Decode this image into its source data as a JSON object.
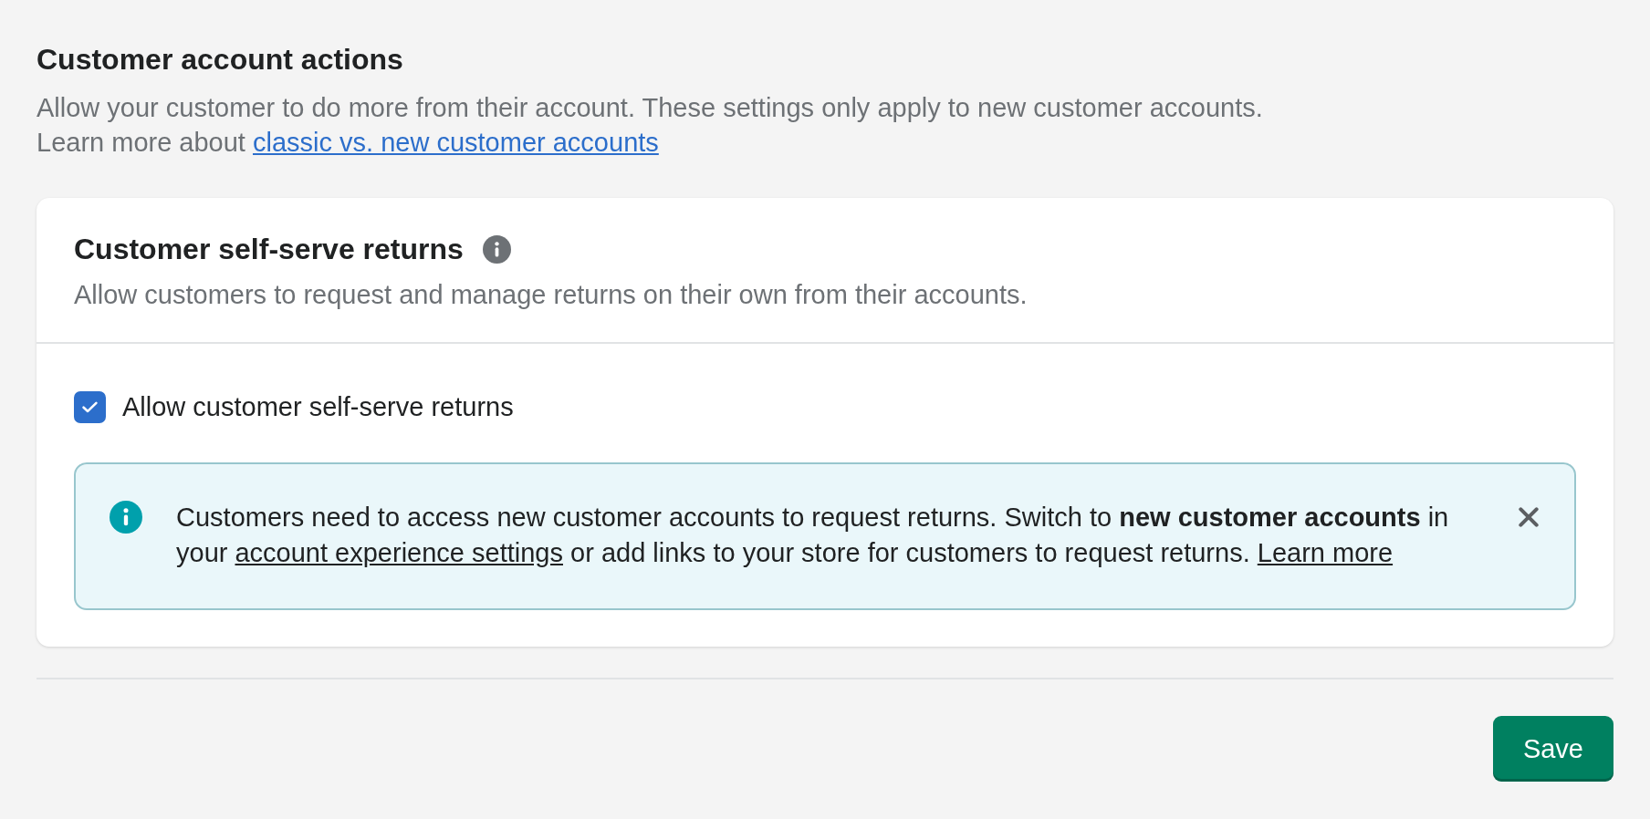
{
  "section": {
    "title": "Customer account actions",
    "description": "Allow your customer to do more from their account. These settings only apply to new customer accounts.",
    "learn_more": {
      "text": "Learn more about",
      "link": "classic vs. new customer accounts"
    }
  },
  "card": {
    "title": "Customer self-serve returns",
    "description": "Allow customers to request and manage returns on their own from their accounts.",
    "checkbox": {
      "label": "Allow customer self-serve returns",
      "checked": true
    },
    "banner": {
      "message": [
        {
          "kind": "text",
          "text": "Customers need to access new customer accounts to request returns. Switch to **new customer accounts** in your"
        },
        {
          "kind": "link",
          "text": "account experience settings"
        },
        {
          "kind": "text",
          "text": "or add links to your store for customers to request returns."
        },
        {
          "kind": "link",
          "text": "Learn more"
        }
      ]
    }
  },
  "save_button": {
    "label": "Save"
  }
}
